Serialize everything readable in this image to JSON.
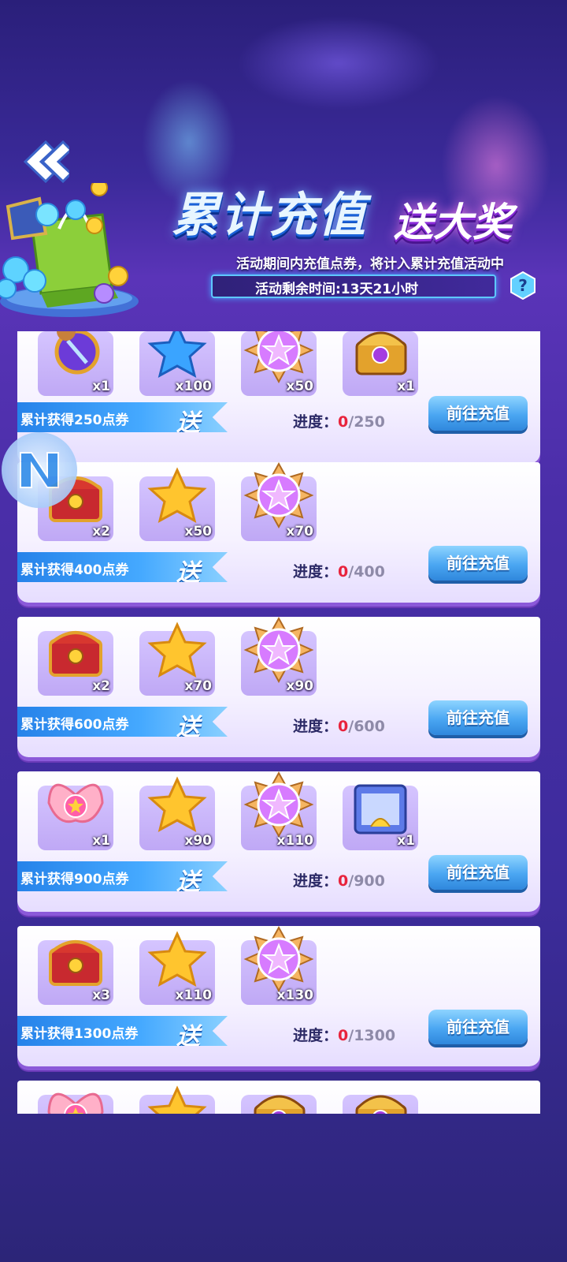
{
  "header": {
    "title_main": "累计充值",
    "title_sub": "送大奖",
    "info_line": "活动期间内充值点券，将计入累计充值活动中",
    "time_remaining": "活动剩余时间:13天21小时",
    "help_symbol": "?"
  },
  "send_label": "送",
  "go_button_label": "前往充值",
  "progress_prefix": "进度：",
  "tiers": [
    {
      "label": "累计获得250点券",
      "current": "0",
      "target": "/250",
      "items": [
        {
          "icon": "badge-icon",
          "qty": "x1"
        },
        {
          "icon": "blue-star-icon",
          "qty": "x100"
        },
        {
          "icon": "star-medal-icon",
          "qty": "x50"
        },
        {
          "icon": "golden-chest-icon",
          "qty": "x1"
        }
      ]
    },
    {
      "label": "累计获得400点券",
      "current": "0",
      "target": "/400",
      "items": [
        {
          "icon": "red-chest-icon",
          "qty": "x2"
        },
        {
          "icon": "gold-star-icon",
          "qty": "x50"
        },
        {
          "icon": "star-medal-icon",
          "qty": "x70"
        }
      ]
    },
    {
      "label": "累计获得600点券",
      "current": "0",
      "target": "/600",
      "items": [
        {
          "icon": "red-chest-icon",
          "qty": "x2"
        },
        {
          "icon": "gold-star-icon",
          "qty": "x70"
        },
        {
          "icon": "star-medal-icon",
          "qty": "x90"
        }
      ]
    },
    {
      "label": "累计获得900点券",
      "current": "0",
      "target": "/900",
      "items": [
        {
          "icon": "pink-wing-icon",
          "qty": "x1"
        },
        {
          "icon": "gold-star-icon",
          "qty": "x90"
        },
        {
          "icon": "star-medal-icon",
          "qty": "x110"
        },
        {
          "icon": "gift-box-icon",
          "qty": "x1"
        }
      ]
    },
    {
      "label": "累计获得1300点券",
      "current": "0",
      "target": "/1300",
      "items": [
        {
          "icon": "red-chest-icon",
          "qty": "x3"
        },
        {
          "icon": "gold-star-icon",
          "qty": "x110"
        },
        {
          "icon": "star-medal-icon",
          "qty": "x130"
        }
      ]
    }
  ],
  "colors": {
    "accent_blue": "#45a9ff",
    "progress_current": "#e8233c",
    "card_shadow": "#8b59d9"
  }
}
